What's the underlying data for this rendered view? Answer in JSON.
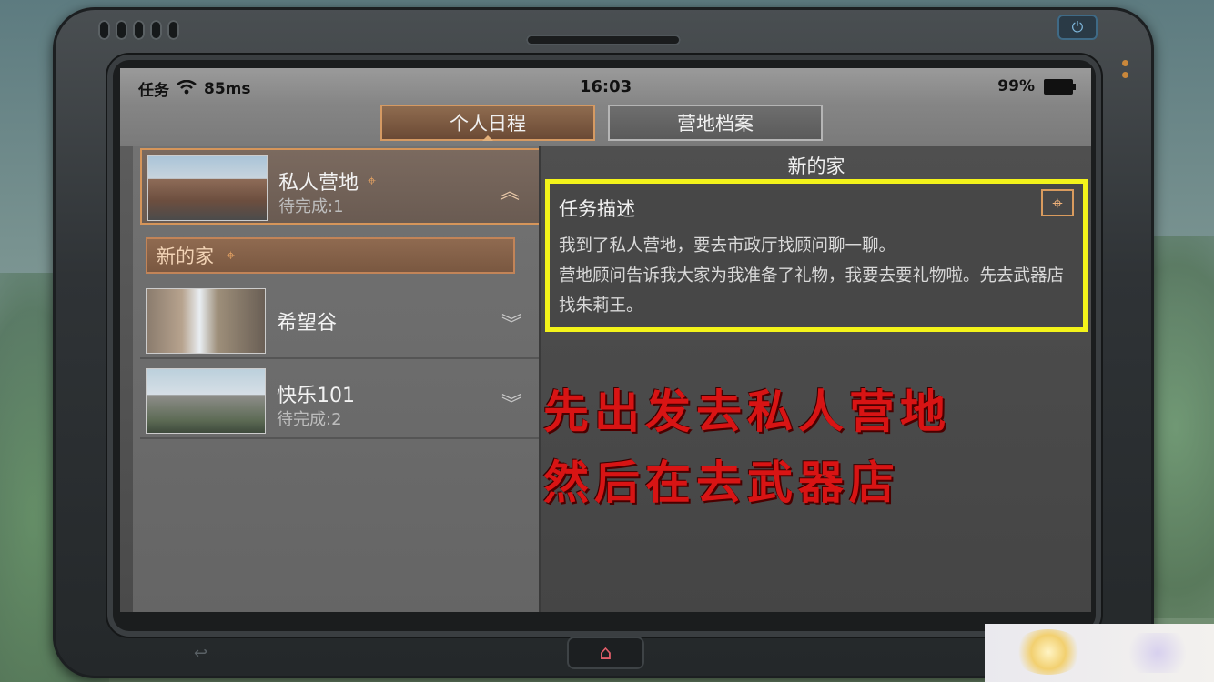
{
  "status_bar": {
    "task_label": "任务",
    "ping": "85ms",
    "time": "16:03",
    "battery": "99%"
  },
  "tabs": [
    {
      "label": "个人日程",
      "active": true
    },
    {
      "label": "营地档案",
      "active": false
    }
  ],
  "camps": [
    {
      "name": "私人营地",
      "status": "待完成:1",
      "expanded": true
    },
    {
      "name": "希望谷",
      "status": "",
      "expanded": false
    },
    {
      "name": "快乐101",
      "status": "待完成:2",
      "expanded": false
    }
  ],
  "subtask": {
    "label": "新的家"
  },
  "detail": {
    "title": "新的家",
    "section_heading": "任务描述",
    "description": "我到了私人营地，要去市政厅找顾问聊一聊。\n营地顾问告诉我大家为我准备了礼物，我要去要礼物啦。先去武器店找朱莉王。"
  },
  "annotation": {
    "line1": "先出发去私人营地",
    "line2": "然后在去武器店"
  },
  "colors": {
    "highlight_border": "#f3f31a",
    "annotation_red": "#d81414",
    "accent_orange": "#d5955a"
  }
}
